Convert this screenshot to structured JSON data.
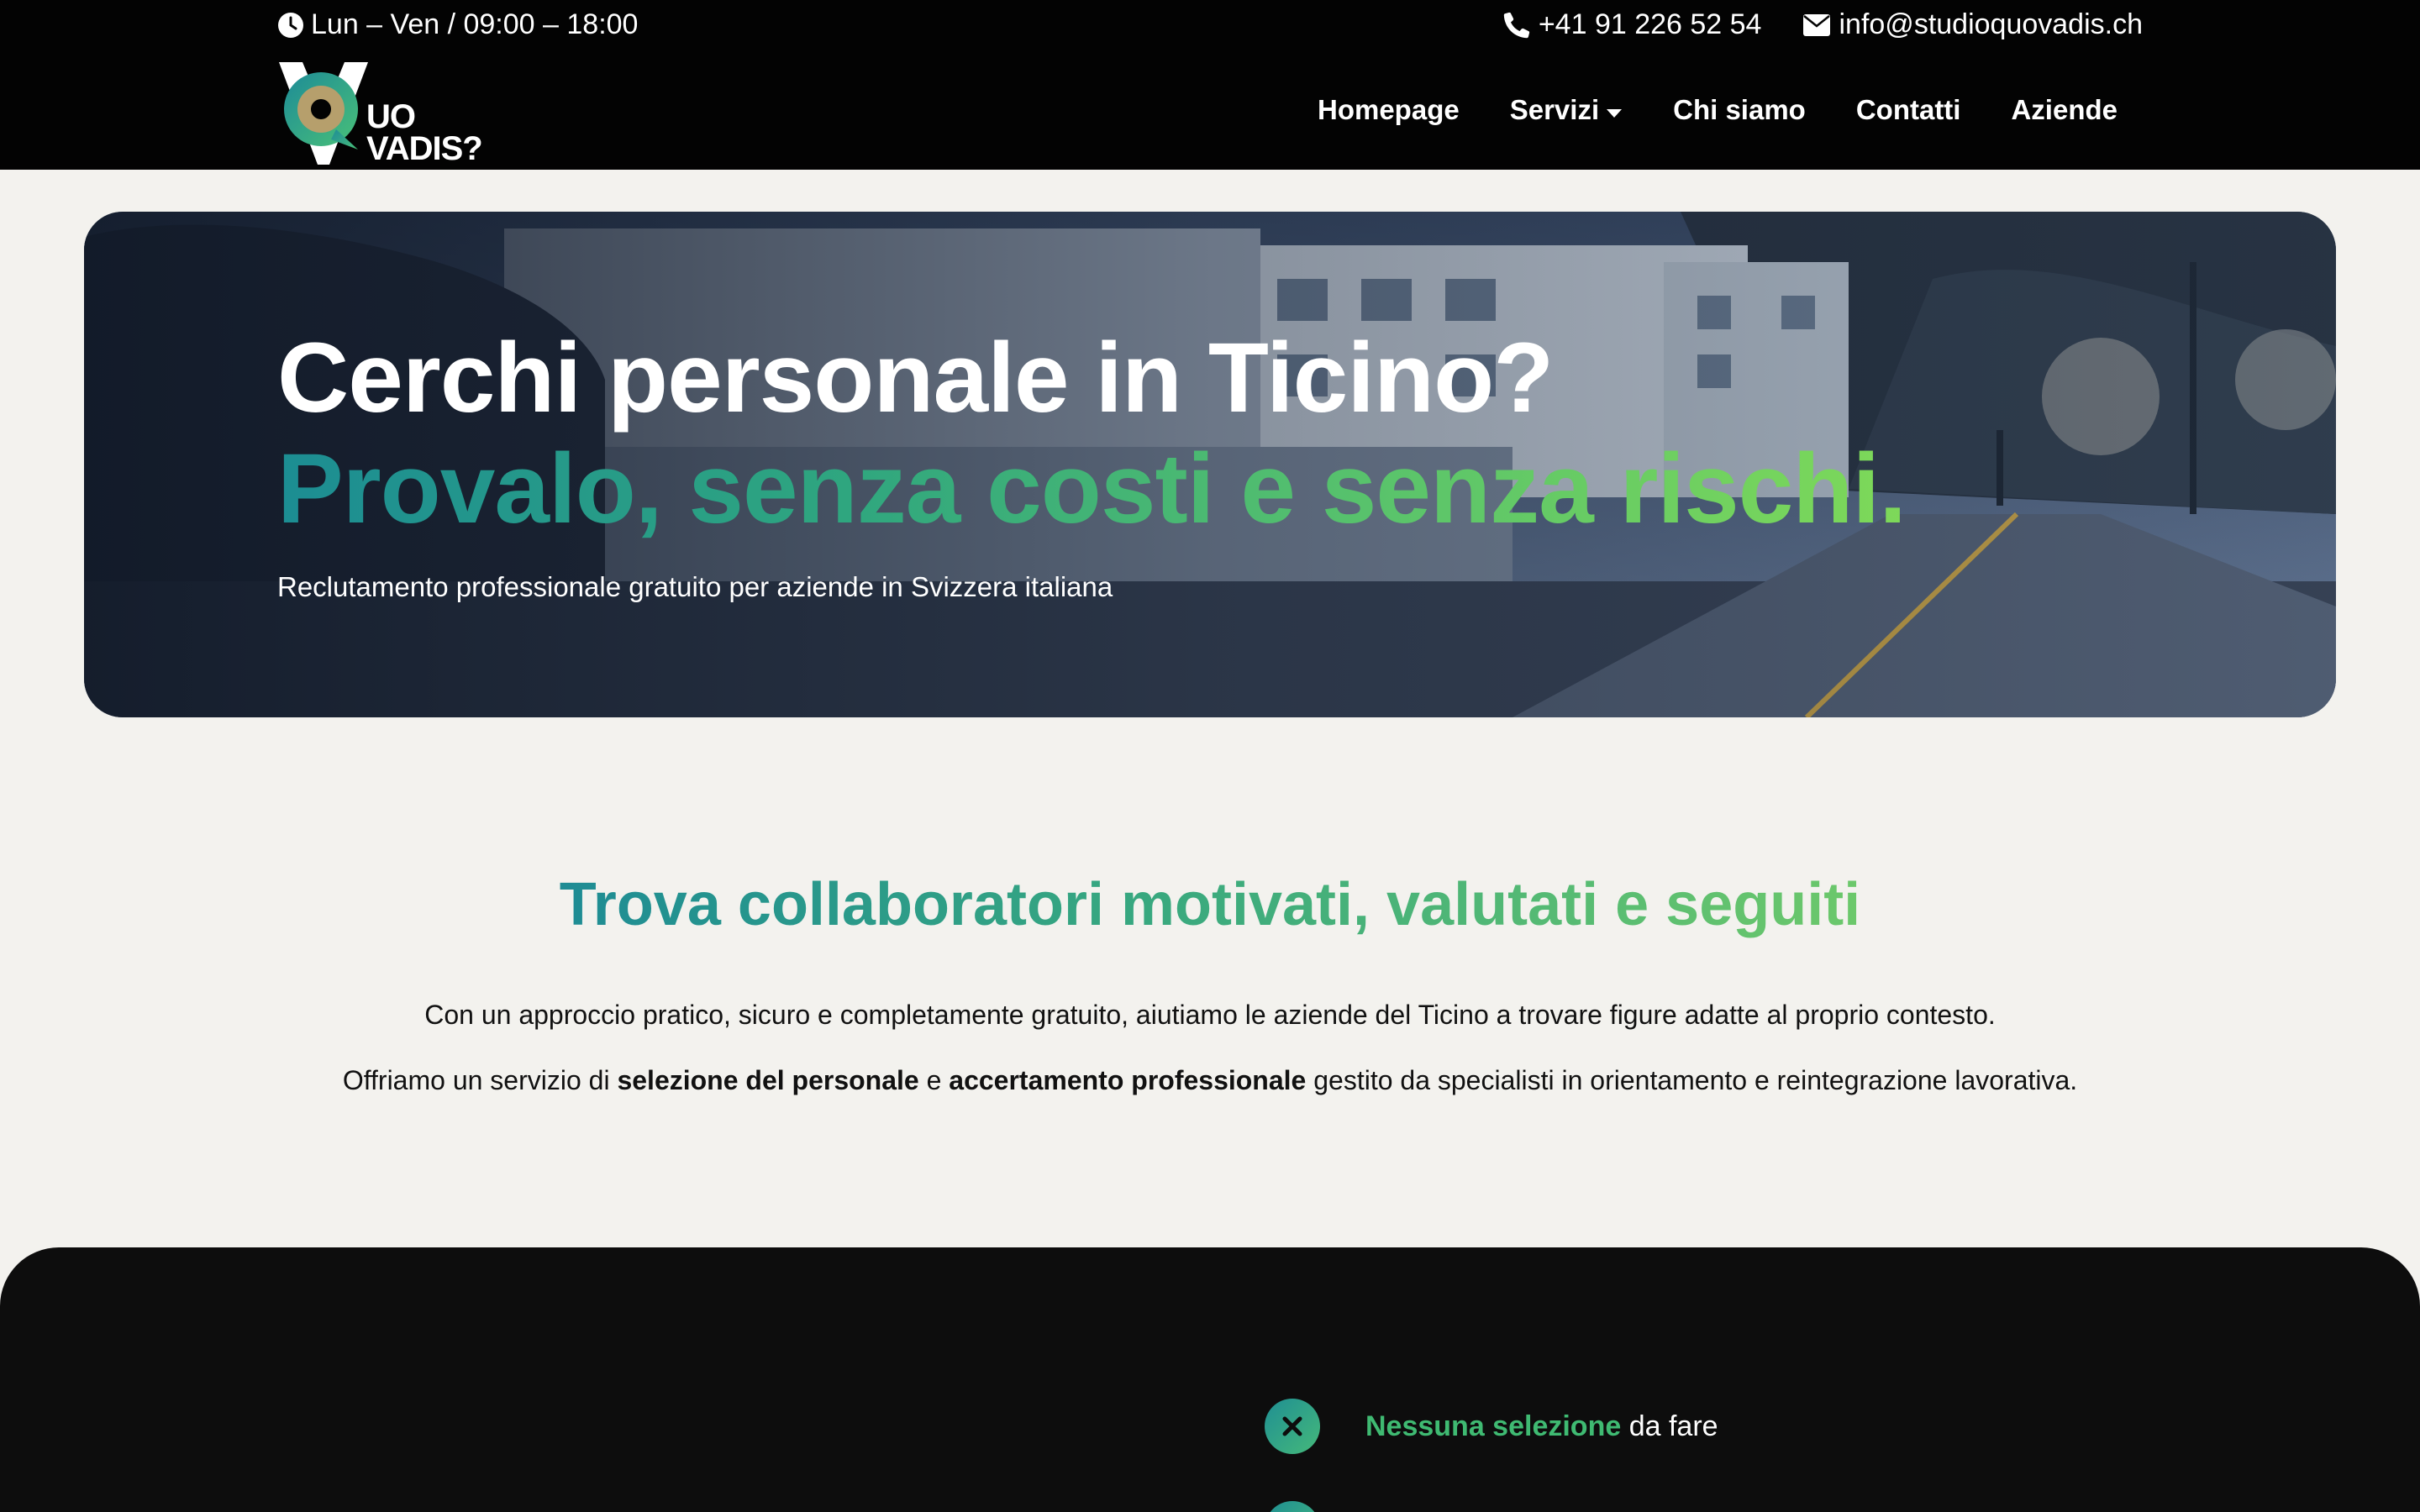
{
  "topbar": {
    "hours": "Lun – Ven / 09:00 – 18:00",
    "phone": "+41 91 226 52 54",
    "email": "info@studioquovadis.ch"
  },
  "logo": {
    "line1": "UO",
    "line2": "VADIS?"
  },
  "nav": {
    "items": [
      {
        "label": "Homepage"
      },
      {
        "label": "Servizi"
      },
      {
        "label": "Chi siamo"
      },
      {
        "label": "Contatti"
      },
      {
        "label": "Aziende"
      }
    ]
  },
  "hero": {
    "title_line1": "Cerchi personale in Ticino?",
    "title_line2": "Provalo, senza costi e senza rischi.",
    "subtitle": "Reclutamento professionale gratuito per aziende in Svizzera italiana"
  },
  "intro": {
    "title": "Trova collaboratori motivati, valutati e seguiti",
    "paragraph1": "Con un approccio pratico, sicuro e completamente gratuito, aiutiamo le aziende del Ticino a trovare figure adatte al proprio contesto.",
    "paragraph2_pre": "Offriamo un servizio di ",
    "paragraph2_b1": "selezione del personale",
    "paragraph2_mid": " e ",
    "paragraph2_b2": "accertamento professionale",
    "paragraph2_post": " gestito da specialisti in orientamento e reintegrazione lavorativa."
  },
  "features": {
    "item1_highlight": "Nessuna selezione",
    "item1_rest": " da fare"
  },
  "icons": {
    "hours": "clock-icon",
    "phone": "phone-icon",
    "email": "envelope-icon",
    "dropdown": "caret-down-icon",
    "feature": "close-icon"
  },
  "colors": {
    "header_bg": "#030303",
    "page_bg": "#f3f2ee",
    "accent_teal": "#1c8d93",
    "accent_green": "#7ed959",
    "dark_section_bg": "#0d0d0d"
  }
}
